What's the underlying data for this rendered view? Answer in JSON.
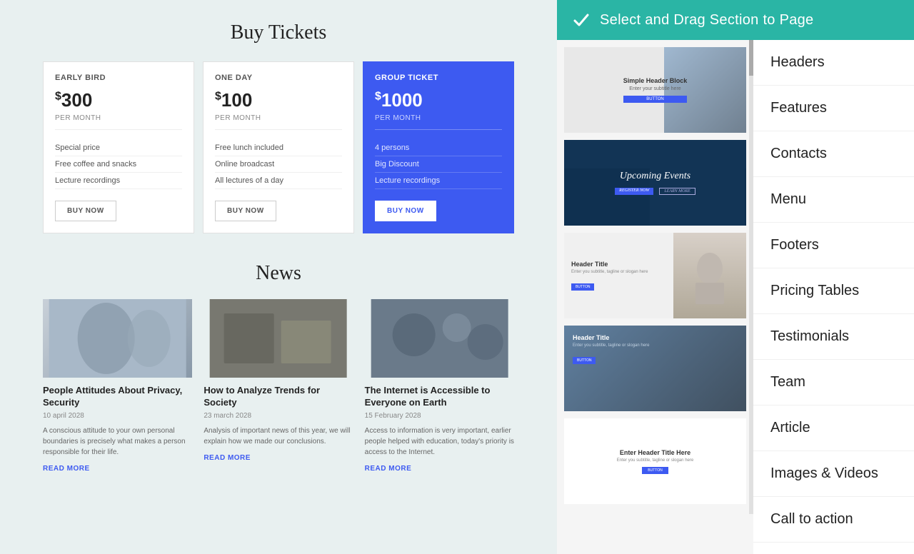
{
  "topbar": {
    "title": "Select and  Drag Section to  Page",
    "check_icon": "✓"
  },
  "pricing_section": {
    "title": "Buy Tickets",
    "cards": [
      {
        "tier": "EARLY BIRD",
        "price": "300",
        "per_month": "PER MONTH",
        "features": [
          "Special price",
          "Free coffee and snacks",
          "Lecture recordings"
        ],
        "button": "BUY NOW"
      },
      {
        "tier": "ONE DAY",
        "price": "100",
        "per_month": "PER MONTH",
        "features": [
          "Free lunch included",
          "Online broadcast",
          "All lectures of a day"
        ],
        "button": "BUY NOW"
      },
      {
        "tier": "GROUP TICKET",
        "price": "1000",
        "per_month": "PER MONTH",
        "features": [
          "4 persons",
          "Big Discount",
          "Lecture recordings"
        ],
        "button": "BUY NOW",
        "featured": true
      }
    ]
  },
  "news_section": {
    "title": "News",
    "articles": [
      {
        "title": "People Attitudes About Privacy, Security",
        "date": "10 april 2028",
        "description": "A conscious attitude to your own personal boundaries is precisely what makes a person responsible for their life.",
        "read_more": "READ MORE",
        "img_bg": "#a8b8c8"
      },
      {
        "title": "How to Analyze Trends for Society",
        "date": "23 march 2028",
        "description": "Analysis of important news of this year, we will explain how we made our conclusions.",
        "read_more": "READ MORE",
        "img_bg": "#787870"
      },
      {
        "title": "The Internet is Accessible to Everyone on Earth",
        "date": "15 February 2028",
        "description": "Access to information is very important, earlier people helped with education, today's priority is access to the Internet.",
        "read_more": "READ MORE",
        "img_bg": "#6a7a8a"
      }
    ]
  },
  "categories": [
    "Headers",
    "Features",
    "Contacts",
    "Menu",
    "Footers",
    "Pricing Tables",
    "Testimonials",
    "Team",
    "Article",
    "Images & Videos",
    "Call to action"
  ],
  "thumbnails": [
    {
      "id": "thumb1",
      "type": "simple-header",
      "title": "Simple Header Block",
      "subtitle": "Enter your subtitle here"
    },
    {
      "id": "thumb2",
      "type": "events",
      "text": "Upcoming Events"
    },
    {
      "id": "thumb3",
      "type": "pricing",
      "title": "Header Title",
      "subtitle": "Enter you subtitle, tagline or slogan here"
    },
    {
      "id": "thumb4",
      "type": "team",
      "title": "Header Title",
      "subtitle": "Enter you subtitle, tagline or slogan here"
    },
    {
      "id": "thumb5",
      "type": "plain",
      "title": "Enter Header Title Here",
      "subtitle": "Enter you subtitle, tagline or slogan here"
    }
  ]
}
